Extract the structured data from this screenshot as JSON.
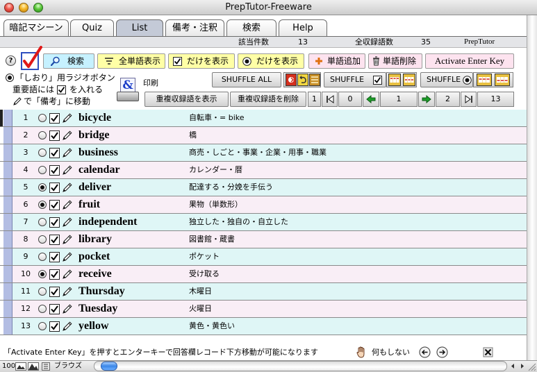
{
  "window": {
    "title": "PrepTutor-Freeware"
  },
  "tabs": [
    {
      "label": "暗記マシーン",
      "active": false
    },
    {
      "label": "Quiz",
      "active": false
    },
    {
      "label": "List",
      "active": true
    },
    {
      "label": "備考・注釈",
      "active": false
    },
    {
      "label": "検索",
      "active": false
    },
    {
      "label": "Help",
      "active": false
    }
  ],
  "info": {
    "found_label": "該当件数",
    "found_count": "13",
    "total_label": "全収録語数",
    "total_count": "35",
    "brand": "PrepTutor"
  },
  "toolbar": {
    "help_label": "?",
    "search_label": "検索",
    "show_all_label": "全単語表示",
    "show_checked_label": "だけを表示",
    "show_bookmarked_label": "だけを表示",
    "add_word_label": "単語追加",
    "delete_word_label": "単語削除",
    "activate_enter_label": "Activate Enter Key"
  },
  "legend": {
    "bookmark_text": "「しおり」用ラジオボタン",
    "important_prefix": "重要語には",
    "important_suffix": "を入れる",
    "notes_text": "で「備考」に移動"
  },
  "print": {
    "glyph": "&",
    "label": "印刷"
  },
  "shuffle": {
    "all_label": "SHUFFLE ALL",
    "checked_label": "SHUFFLE",
    "bookmarked_label": "SHUFFLE"
  },
  "duplicates": {
    "show_label": "重複収録語を表示",
    "delete_label": "重複収録語を削除"
  },
  "navigation": {
    "start_value": "1",
    "previous_value": "0",
    "current_value": "1",
    "next_value": "2",
    "last_value": "13"
  },
  "rows": [
    {
      "number": "1",
      "word": "bicycle",
      "meaning": "自転車・= bike",
      "bookmarked": false,
      "important": true,
      "current": true
    },
    {
      "number": "2",
      "word": "bridge",
      "meaning": "橋",
      "bookmarked": false,
      "important": true
    },
    {
      "number": "3",
      "word": "business",
      "meaning": "商売・しごと・事業・企業・用事・職業",
      "bookmarked": false,
      "important": true
    },
    {
      "number": "4",
      "word": "calendar",
      "meaning": "カレンダー・暦",
      "bookmarked": false,
      "important": true
    },
    {
      "number": "5",
      "word": "deliver",
      "meaning": "配達する・分娩を手伝う",
      "bookmarked": true,
      "important": true
    },
    {
      "number": "6",
      "word": "fruit",
      "meaning": "果物（単数形）",
      "bookmarked": true,
      "important": true
    },
    {
      "number": "7",
      "word": "independent",
      "meaning": "独立した・独自の・自立した",
      "bookmarked": false,
      "important": true
    },
    {
      "number": "8",
      "word": "library",
      "meaning": "図書館・蔵書",
      "bookmarked": false,
      "important": true
    },
    {
      "number": "9",
      "word": "pocket",
      "meaning": "ポケット",
      "bookmarked": false,
      "important": true
    },
    {
      "number": "10",
      "word": "receive",
      "meaning": "受け取る",
      "bookmarked": true,
      "important": true
    },
    {
      "number": "11",
      "word": "Thursday",
      "meaning": "木曜日",
      "bookmarked": false,
      "important": true
    },
    {
      "number": "12",
      "word": "Tuesday",
      "meaning": "火曜日",
      "bookmarked": false,
      "important": true
    },
    {
      "number": "13",
      "word": "yellow",
      "meaning": "黄色・黄色い",
      "bookmarked": false,
      "important": true
    }
  ],
  "status": {
    "message": "「Activate Enter Key」を押すとエンターキーで回答欄レコード下方移動が可能になります",
    "action_label": "何もしない"
  },
  "bottom_bar": {
    "zoom": "100",
    "mode": "ブラウズ"
  },
  "colors": {
    "row_odd": "#dff6f6",
    "row_even": "#f9eef6",
    "record_strip": "#b3bde3",
    "search_button": "#c6f1ff",
    "filter_button": "#ffffa6",
    "edit_button": "#fde3ef",
    "active_tab": "#c4cad7",
    "check_mark_red": "#e01818",
    "nav_arrow_green": "#1ea02a"
  },
  "icons": {
    "help": "question-icon",
    "mark": "red-checkmark-icon",
    "search": "magnifier-icon",
    "show_all": "filter-icon",
    "add": "plus-icon",
    "delete": "trash-icon",
    "print": "print-icon",
    "row_note": "pencil-icon",
    "status_hand": "hand-icon",
    "close": "x-icon"
  }
}
